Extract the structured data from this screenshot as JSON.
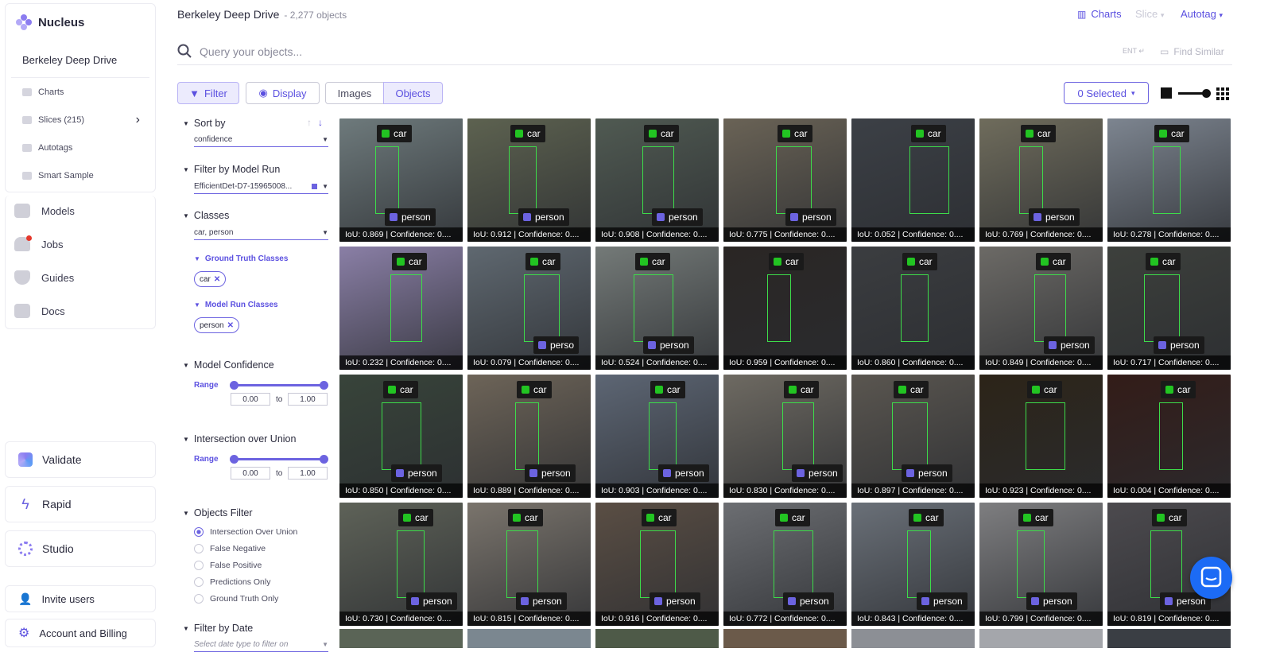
{
  "app": {
    "name": "Nucleus"
  },
  "sidebar": {
    "dataset": "Berkeley Deep Drive",
    "subitems": [
      {
        "label": "Charts",
        "icon": "chart-icon"
      },
      {
        "label": "Slices (215)",
        "icon": "slices-icon"
      },
      {
        "label": "Autotags",
        "icon": "tag-icon"
      },
      {
        "label": "Smart Sample",
        "icon": "sample-icon"
      }
    ],
    "items": [
      {
        "label": "Models",
        "icon": "models-icon"
      },
      {
        "label": "Jobs",
        "icon": "bell-icon"
      },
      {
        "label": "Guides",
        "icon": "guides-icon"
      },
      {
        "label": "Docs",
        "icon": "docs-icon"
      }
    ],
    "products": [
      "Validate",
      "Rapid",
      "Studio"
    ],
    "invite": "Invite users",
    "account": "Account and Billing"
  },
  "header": {
    "title": "Berkeley Deep Drive",
    "count": "- 2,277 objects",
    "charts": "Charts",
    "slice": "Slice",
    "autotag": "Autotag"
  },
  "search": {
    "placeholder": "Query your objects...",
    "ent": "ENT",
    "find_similar": "Find Similar"
  },
  "toolbar": {
    "filter": "Filter",
    "display": "Display",
    "images": "Images",
    "objects": "Objects",
    "selected": "0 Selected"
  },
  "filters": {
    "sort_by": "Sort by",
    "sort_value": "confidence",
    "model_run": "Filter by Model Run",
    "model_run_value": "EfficientDet-D7-15965008...",
    "classes": "Classes",
    "classes_value": "car, person",
    "gt_classes": "Ground Truth Classes",
    "gt_chip": "car",
    "mr_classes": "Model Run Classes",
    "mr_chip": "person",
    "confidence": "Model Confidence",
    "iou": "Intersection over Union",
    "range": "Range",
    "min": "0.00",
    "to": "to",
    "max": "1.00",
    "objects_filter": "Objects Filter",
    "radios": [
      "Intersection Over Union",
      "False Negative",
      "False Positive",
      "Predictions Only",
      "Ground Truth Only"
    ],
    "date": "Filter by Date",
    "date_placeholder": "Select date type to filter on"
  },
  "tiles": [
    {
      "iou": "IoU: 0.869 | Confidence: 0....",
      "car": "car",
      "person": "person"
    },
    {
      "iou": "IoU: 0.912 | Confidence: 0....",
      "car": "car",
      "person": "person"
    },
    {
      "iou": "IoU: 0.908 | Confidence: 0....",
      "car": "car",
      "person": "person"
    },
    {
      "iou": "IoU: 0.775 | Confidence: 0....",
      "car": "car",
      "person": "person"
    },
    {
      "iou": "IoU: 0.052 | Confidence: 0....",
      "car": "car",
      "person": ""
    },
    {
      "iou": "IoU: 0.769 | Confidence: 0....",
      "car": "car",
      "person": "person"
    },
    {
      "iou": "IoU: 0.278 | Confidence: 0....",
      "car": "car",
      "person": ""
    },
    {
      "iou": "IoU: 0.232 | Confidence: 0....",
      "car": "car",
      "person": ""
    },
    {
      "iou": "IoU: 0.079 | Confidence: 0....",
      "car": "car",
      "person": "perso"
    },
    {
      "iou": "IoU: 0.524 | Confidence: 0....",
      "car": "car",
      "person": "person"
    },
    {
      "iou": "IoU: 0.959 | Confidence: 0....",
      "car": "car",
      "person": ""
    },
    {
      "iou": "IoU: 0.860 | Confidence: 0....",
      "car": "car",
      "person": ""
    },
    {
      "iou": "IoU: 0.849 | Confidence: 0....",
      "car": "car",
      "person": "person"
    },
    {
      "iou": "IoU: 0.717 | Confidence: 0....",
      "car": "car",
      "person": "person"
    },
    {
      "iou": "IoU: 0.850 | Confidence: 0....",
      "car": "car",
      "person": "person"
    },
    {
      "iou": "IoU: 0.889 | Confidence: 0....",
      "car": "car",
      "person": "person"
    },
    {
      "iou": "IoU: 0.903 | Confidence: 0....",
      "car": "car",
      "person": "person"
    },
    {
      "iou": "IoU: 0.830 | Confidence: 0....",
      "car": "car",
      "person": "person"
    },
    {
      "iou": "IoU: 0.897 | Confidence: 0....",
      "car": "car",
      "person": "person"
    },
    {
      "iou": "IoU: 0.923 | Confidence: 0....",
      "car": "car",
      "person": ""
    },
    {
      "iou": "IoU: 0.004 | Confidence: 0....",
      "car": "car",
      "person": ""
    },
    {
      "iou": "IoU: 0.730 | Confidence: 0....",
      "car": "car",
      "person": "person"
    },
    {
      "iou": "IoU: 0.815 | Confidence: 0....",
      "car": "car",
      "person": "person"
    },
    {
      "iou": "IoU: 0.916 | Confidence: 0....",
      "car": "car",
      "person": "person"
    },
    {
      "iou": "IoU: 0.772 | Confidence: 0....",
      "car": "car",
      "person": "person"
    },
    {
      "iou": "IoU: 0.843 | Confidence: 0....",
      "car": "car",
      "person": "person"
    },
    {
      "iou": "IoU: 0.799 | Confidence: 0....",
      "car": "car",
      "person": "person"
    },
    {
      "iou": "IoU: 0.819 | Confidence: 0....",
      "car": "car",
      "person": "person"
    }
  ],
  "colors": {
    "accent": "#5b50e0",
    "gt": "#22c422",
    "pred": "#6c63e0"
  }
}
